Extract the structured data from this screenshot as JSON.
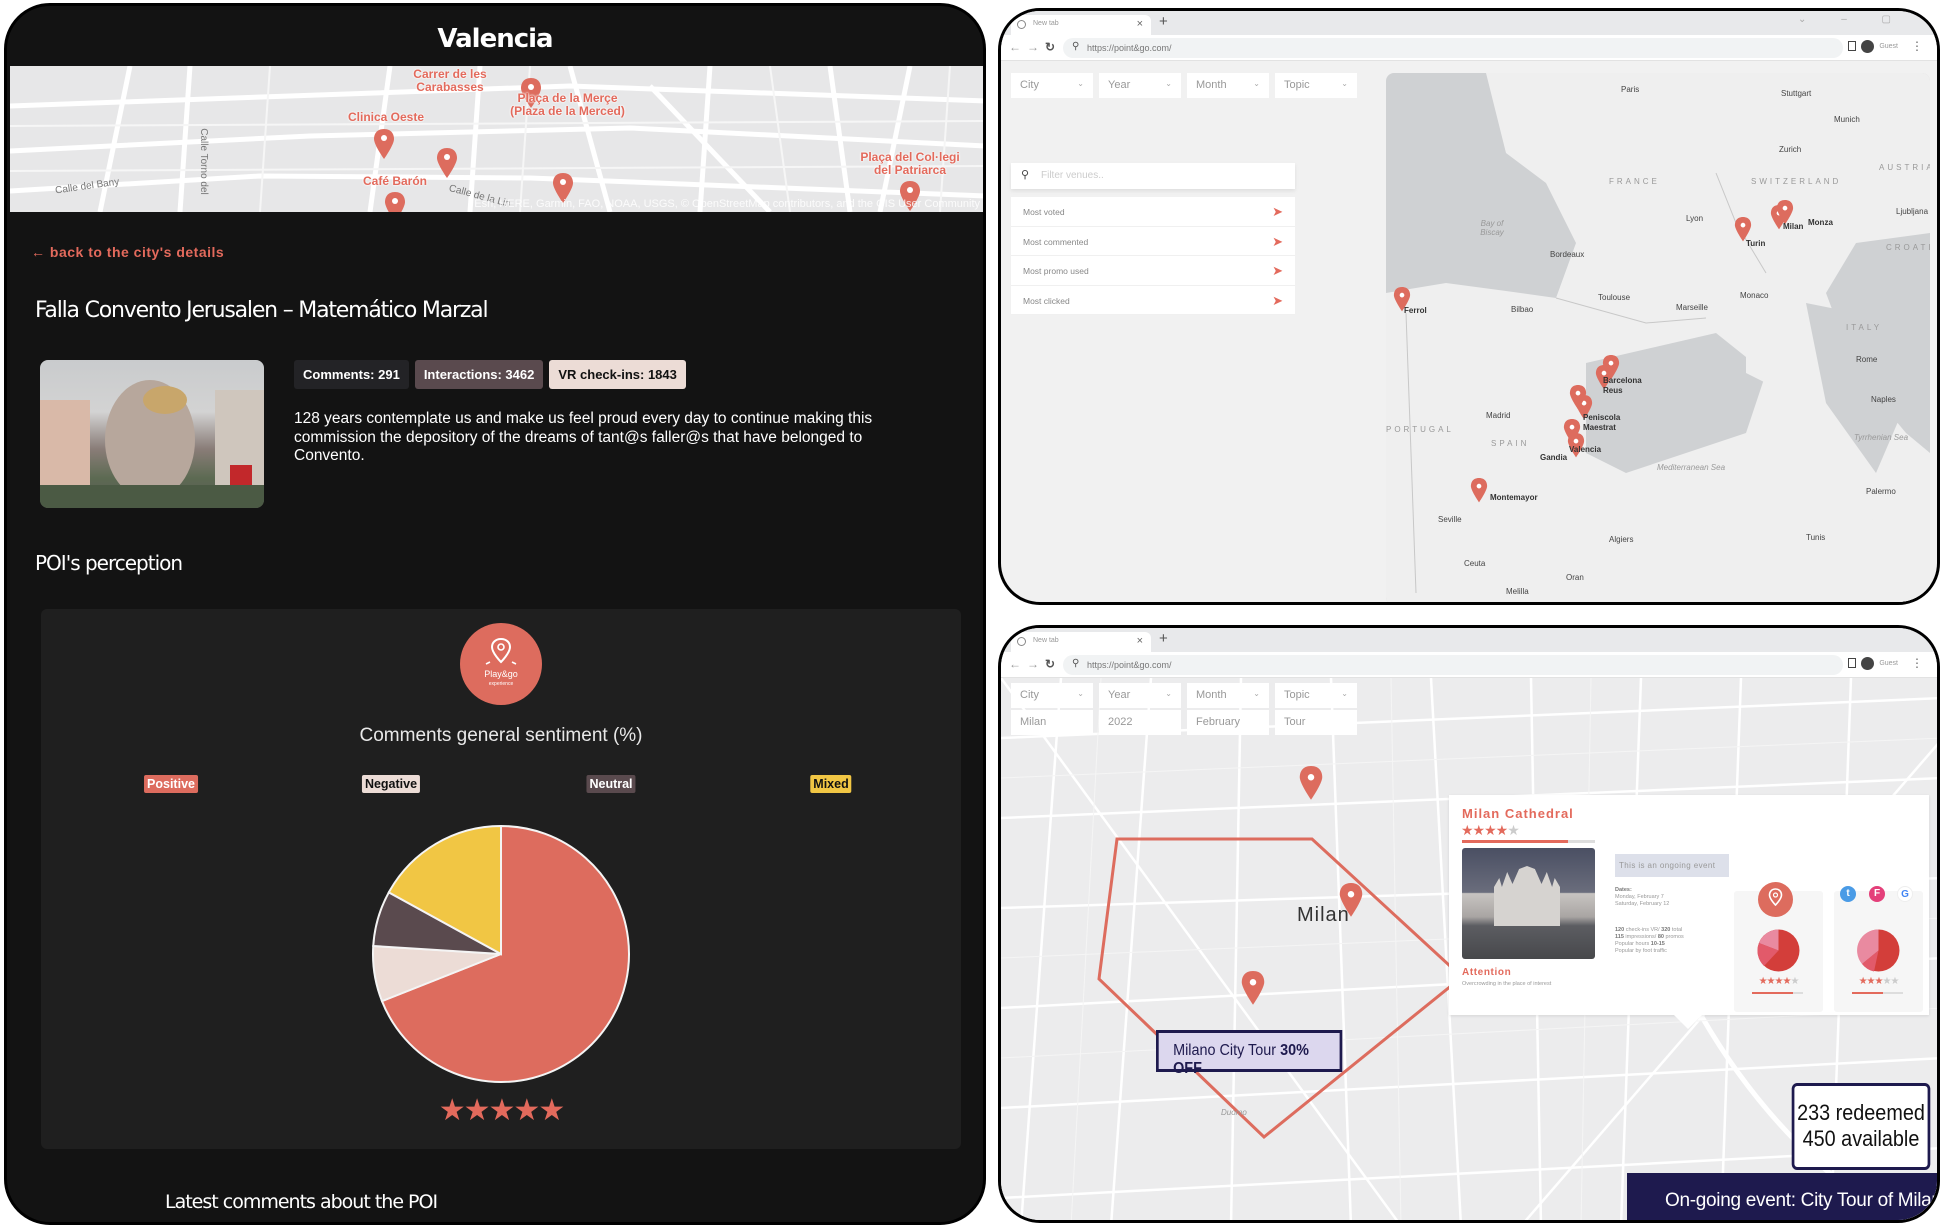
{
  "left": {
    "city_title": "Valencia",
    "map": {
      "labels": [
        "Carrer de les Carabasses",
        "Plaça de la Merçe (Plaza de la Merced)",
        "Clinica Oeste",
        "Café Barón",
        "Plaça del Col·legi del Patriarca"
      ],
      "streets": [
        "Calle del Bany",
        "Calle Torno del",
        "Calle de la Lin"
      ],
      "attribution": "Esri, HERE, Garmin, FAO, NOAA, USGS, © OpenStreetMap contributors, and the GIS User Community"
    },
    "back_link": "back to the city's details",
    "poi_title": "Falla Convento Jerusalen – Matemático Marzal",
    "badges": {
      "comments": "Comments: 291",
      "interactions": "Interactions: 3462",
      "vr_checkins": "VR check-ins: 1843"
    },
    "description": "128 years contemplate us and make us feel proud every day to continue making this commission the depository of the dreams of tant@s faller@s that have belonged to Convento.",
    "section_title": "POI's perception",
    "logo": {
      "name": "Play&go",
      "sub": "experience"
    },
    "rating_stars": 5,
    "rating_text": "★★★★★",
    "latest_comments_title": "Latest comments about the POI"
  },
  "chart_data": {
    "type": "pie",
    "title": "Comments general sentiment (%)",
    "categories": [
      "Positive",
      "Negative",
      "Neutral",
      "Mixed"
    ],
    "values": [
      69,
      7,
      7,
      17
    ],
    "colors": [
      "#dd6c5e",
      "#ecdcd6",
      "#5a4a4e",
      "#f1c644"
    ],
    "legend_text_colors": [
      "#ffffff",
      "#111111",
      "#ffffff",
      "#111111"
    ],
    "legend_placement": "top",
    "start_angle": "12 o'clock, clockwise"
  },
  "browser1": {
    "tab_title": "New tab",
    "url": "https://point&go.com/",
    "profile": "Guest",
    "filters": [
      "City",
      "Year",
      "Month",
      "Topic"
    ],
    "search_placeholder": "Filter venues..",
    "venue_lists": [
      "Most voted",
      "Most commented",
      "Most promo used",
      "Most clicked"
    ],
    "map_labels": {
      "cities": [
        "Paris",
        "Stuttgart",
        "Munich",
        "Zurich",
        "Lyon",
        "Bordeaux",
        "Toulouse",
        "Marseille",
        "Monaco",
        "Bilbao",
        "Madrid",
        "Seville",
        "Rome",
        "Naples",
        "Palermo",
        "Tunis",
        "Algiers",
        "Oran",
        "Ceuta",
        "Melilla",
        "Ljubljana"
      ],
      "countries": [
        "FRANCE",
        "SWITZERLAND",
        "AUSTRIA",
        "CROATIA",
        "ITALY",
        "SPAIN",
        "PORTUGAL"
      ],
      "seas": [
        "Bay of Biscay",
        "Mediterranean Sea",
        "Tyrrhenian Sea"
      ],
      "pois": [
        "Ferrol",
        "Turin",
        "Milan",
        "Monza",
        "Barcelona",
        "Reus",
        "Peniscola",
        "Maestrat",
        "Valencia",
        "Gandia",
        "Montemayor"
      ]
    }
  },
  "browser2": {
    "tab_title": "New tab",
    "url": "https://point&go.com/",
    "profile": "Guest",
    "filters": [
      {
        "label": "City",
        "value": "Milan"
      },
      {
        "label": "Year",
        "value": "2022"
      },
      {
        "label": "Month",
        "value": "February"
      },
      {
        "label": "Topic",
        "value": "Tour"
      }
    ],
    "map_city_label": "Milan",
    "map_area_label": "Duomo",
    "poi_card": {
      "title": "Milan Cathedral",
      "stars": 4,
      "stars_text_on": "★★★★",
      "stars_text_off": "★",
      "rating_fraction": 0.8,
      "ongoing": "This is an ongoing event",
      "dates_label": "Dates:",
      "dates": [
        "Monday, February 7",
        "Saturday, February 12"
      ],
      "stats": [
        {
          "bold": "120",
          "text": " check-ins VR/ ",
          "bold2": "320",
          "text2": " total"
        },
        {
          "bold": "115",
          "text": " impressions/ ",
          "bold2": "80",
          "text2": " promos"
        },
        {
          "bold": "",
          "text": "Popular hours ",
          "bold2": "10-15",
          "text2": ""
        },
        {
          "bold": "",
          "text": "Popular by foot traffic",
          "bold2": "",
          "text2": ""
        }
      ],
      "attention_title": "Attention",
      "attention_text": "Overcrowding in the place of interest",
      "playgo_panel": {
        "stars_on": "★★★★",
        "stars_off": "★",
        "fraction": 0.8
      },
      "social_panel": {
        "stars_on": "★★★",
        "stars_off": "★★",
        "fraction": 0.6,
        "icons": [
          "twitter-icon",
          "foursquare-icon",
          "google-icon"
        ]
      }
    },
    "promo": {
      "text": "Milano City Tour ",
      "bold": "30% OFF"
    },
    "redeem": {
      "redeemed": "233 redeemed",
      "available": "450 available"
    },
    "ongoing_banner": "On-going event: City Tour of Milan"
  }
}
